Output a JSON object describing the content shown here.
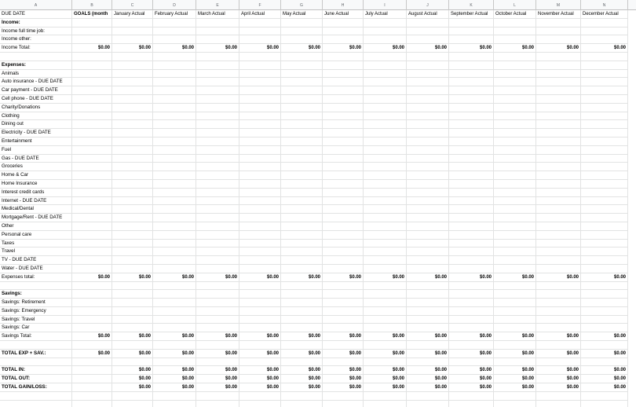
{
  "columns": [
    "A",
    "B",
    "C",
    "D",
    "E",
    "F",
    "G",
    "H",
    "I",
    "J",
    "K",
    "L",
    "M",
    "N"
  ],
  "header_row": [
    "DUE DATE",
    "GOALS (month",
    "January Actual",
    "February Actual",
    "March Actual",
    "April Actual",
    "May Actual",
    "June Actual",
    "July Actual",
    "August Actual",
    "September Actual",
    "October Actual",
    "November Actual",
    "December Actual"
  ],
  "zero": "$0.00",
  "rows": [
    {
      "label": "Income:",
      "style": "bold",
      "values": "none"
    },
    {
      "label": "Income full time job:",
      "style": "normal",
      "values": "none"
    },
    {
      "label": "Income other:",
      "style": "normal",
      "values": "none"
    },
    {
      "label": "Income Total:",
      "style": "normal",
      "values": "all"
    },
    {
      "label": "",
      "style": "normal",
      "values": "none"
    },
    {
      "label": "Expenses:",
      "style": "bold",
      "values": "none"
    },
    {
      "label": "Animals",
      "style": "normal",
      "values": "none"
    },
    {
      "label": "Auto insurance - DUE DATE",
      "style": "normal",
      "values": "none"
    },
    {
      "label": "Car payment - DUE DATE",
      "style": "normal",
      "values": "none"
    },
    {
      "label": "Cell phone - DUE DATE",
      "style": "normal",
      "values": "none"
    },
    {
      "label": "Charity/Donations",
      "style": "normal",
      "values": "none"
    },
    {
      "label": "Clothing",
      "style": "normal",
      "values": "none"
    },
    {
      "label": "Dining out",
      "style": "normal",
      "values": "none"
    },
    {
      "label": "Electricity - DUE DATE",
      "style": "normal",
      "values": "none"
    },
    {
      "label": "Entertainment",
      "style": "normal",
      "values": "none"
    },
    {
      "label": "Fuel",
      "style": "normal",
      "values": "none"
    },
    {
      "label": "Gas - DUE DATE",
      "style": "normal",
      "values": "none"
    },
    {
      "label": "Groceries",
      "style": "normal",
      "values": "none"
    },
    {
      "label": "Home & Car",
      "style": "normal",
      "values": "none"
    },
    {
      "label": "Home Insurance",
      "style": "normal",
      "values": "none"
    },
    {
      "label": "Interest credit cards",
      "style": "normal",
      "values": "none"
    },
    {
      "label": "Internet - DUE DATE",
      "style": "normal",
      "values": "none"
    },
    {
      "label": "Medical/Dental",
      "style": "normal",
      "values": "none"
    },
    {
      "label": "Mortgage/Rent - DUE DATE",
      "style": "normal",
      "values": "none"
    },
    {
      "label": "Other",
      "style": "normal",
      "values": "none"
    },
    {
      "label": "Personal care",
      "style": "normal",
      "values": "none"
    },
    {
      "label": "Taxes",
      "style": "normal",
      "values": "none"
    },
    {
      "label": "Travel",
      "style": "normal",
      "values": "none"
    },
    {
      "label": "TV - DUE DATE",
      "style": "normal",
      "values": "none"
    },
    {
      "label": "Water - DUE DATE",
      "style": "normal",
      "values": "none"
    },
    {
      "label": "Expenses total:",
      "style": "normal",
      "values": "all"
    },
    {
      "label": "",
      "style": "normal",
      "values": "none"
    },
    {
      "label": "Savings:",
      "style": "bold",
      "values": "none"
    },
    {
      "label": "Savings: Retirement",
      "style": "normal",
      "values": "none"
    },
    {
      "label": "Savings: Emergency",
      "style": "normal",
      "values": "none"
    },
    {
      "label": "Savings: Travel",
      "style": "normal",
      "values": "none"
    },
    {
      "label": "Savings: Car",
      "style": "normal",
      "values": "none"
    },
    {
      "label": "Savings Total:",
      "style": "normal",
      "values": "all"
    },
    {
      "label": "",
      "style": "normal",
      "values": "none"
    },
    {
      "label": "TOTAL EXP + SAV.:",
      "style": "bold",
      "values": "all"
    },
    {
      "label": "",
      "style": "normal",
      "values": "none"
    },
    {
      "label": "TOTAL IN:",
      "style": "bold",
      "values": "monthly"
    },
    {
      "label": "TOTAL OUT:",
      "style": "bold",
      "values": "monthly"
    },
    {
      "label": "TOTAL GAIN/LOSS:",
      "style": "bold",
      "values": "monthly"
    },
    {
      "label": "",
      "style": "normal",
      "values": "none"
    },
    {
      "label": "",
      "style": "normal",
      "values": "none"
    }
  ]
}
